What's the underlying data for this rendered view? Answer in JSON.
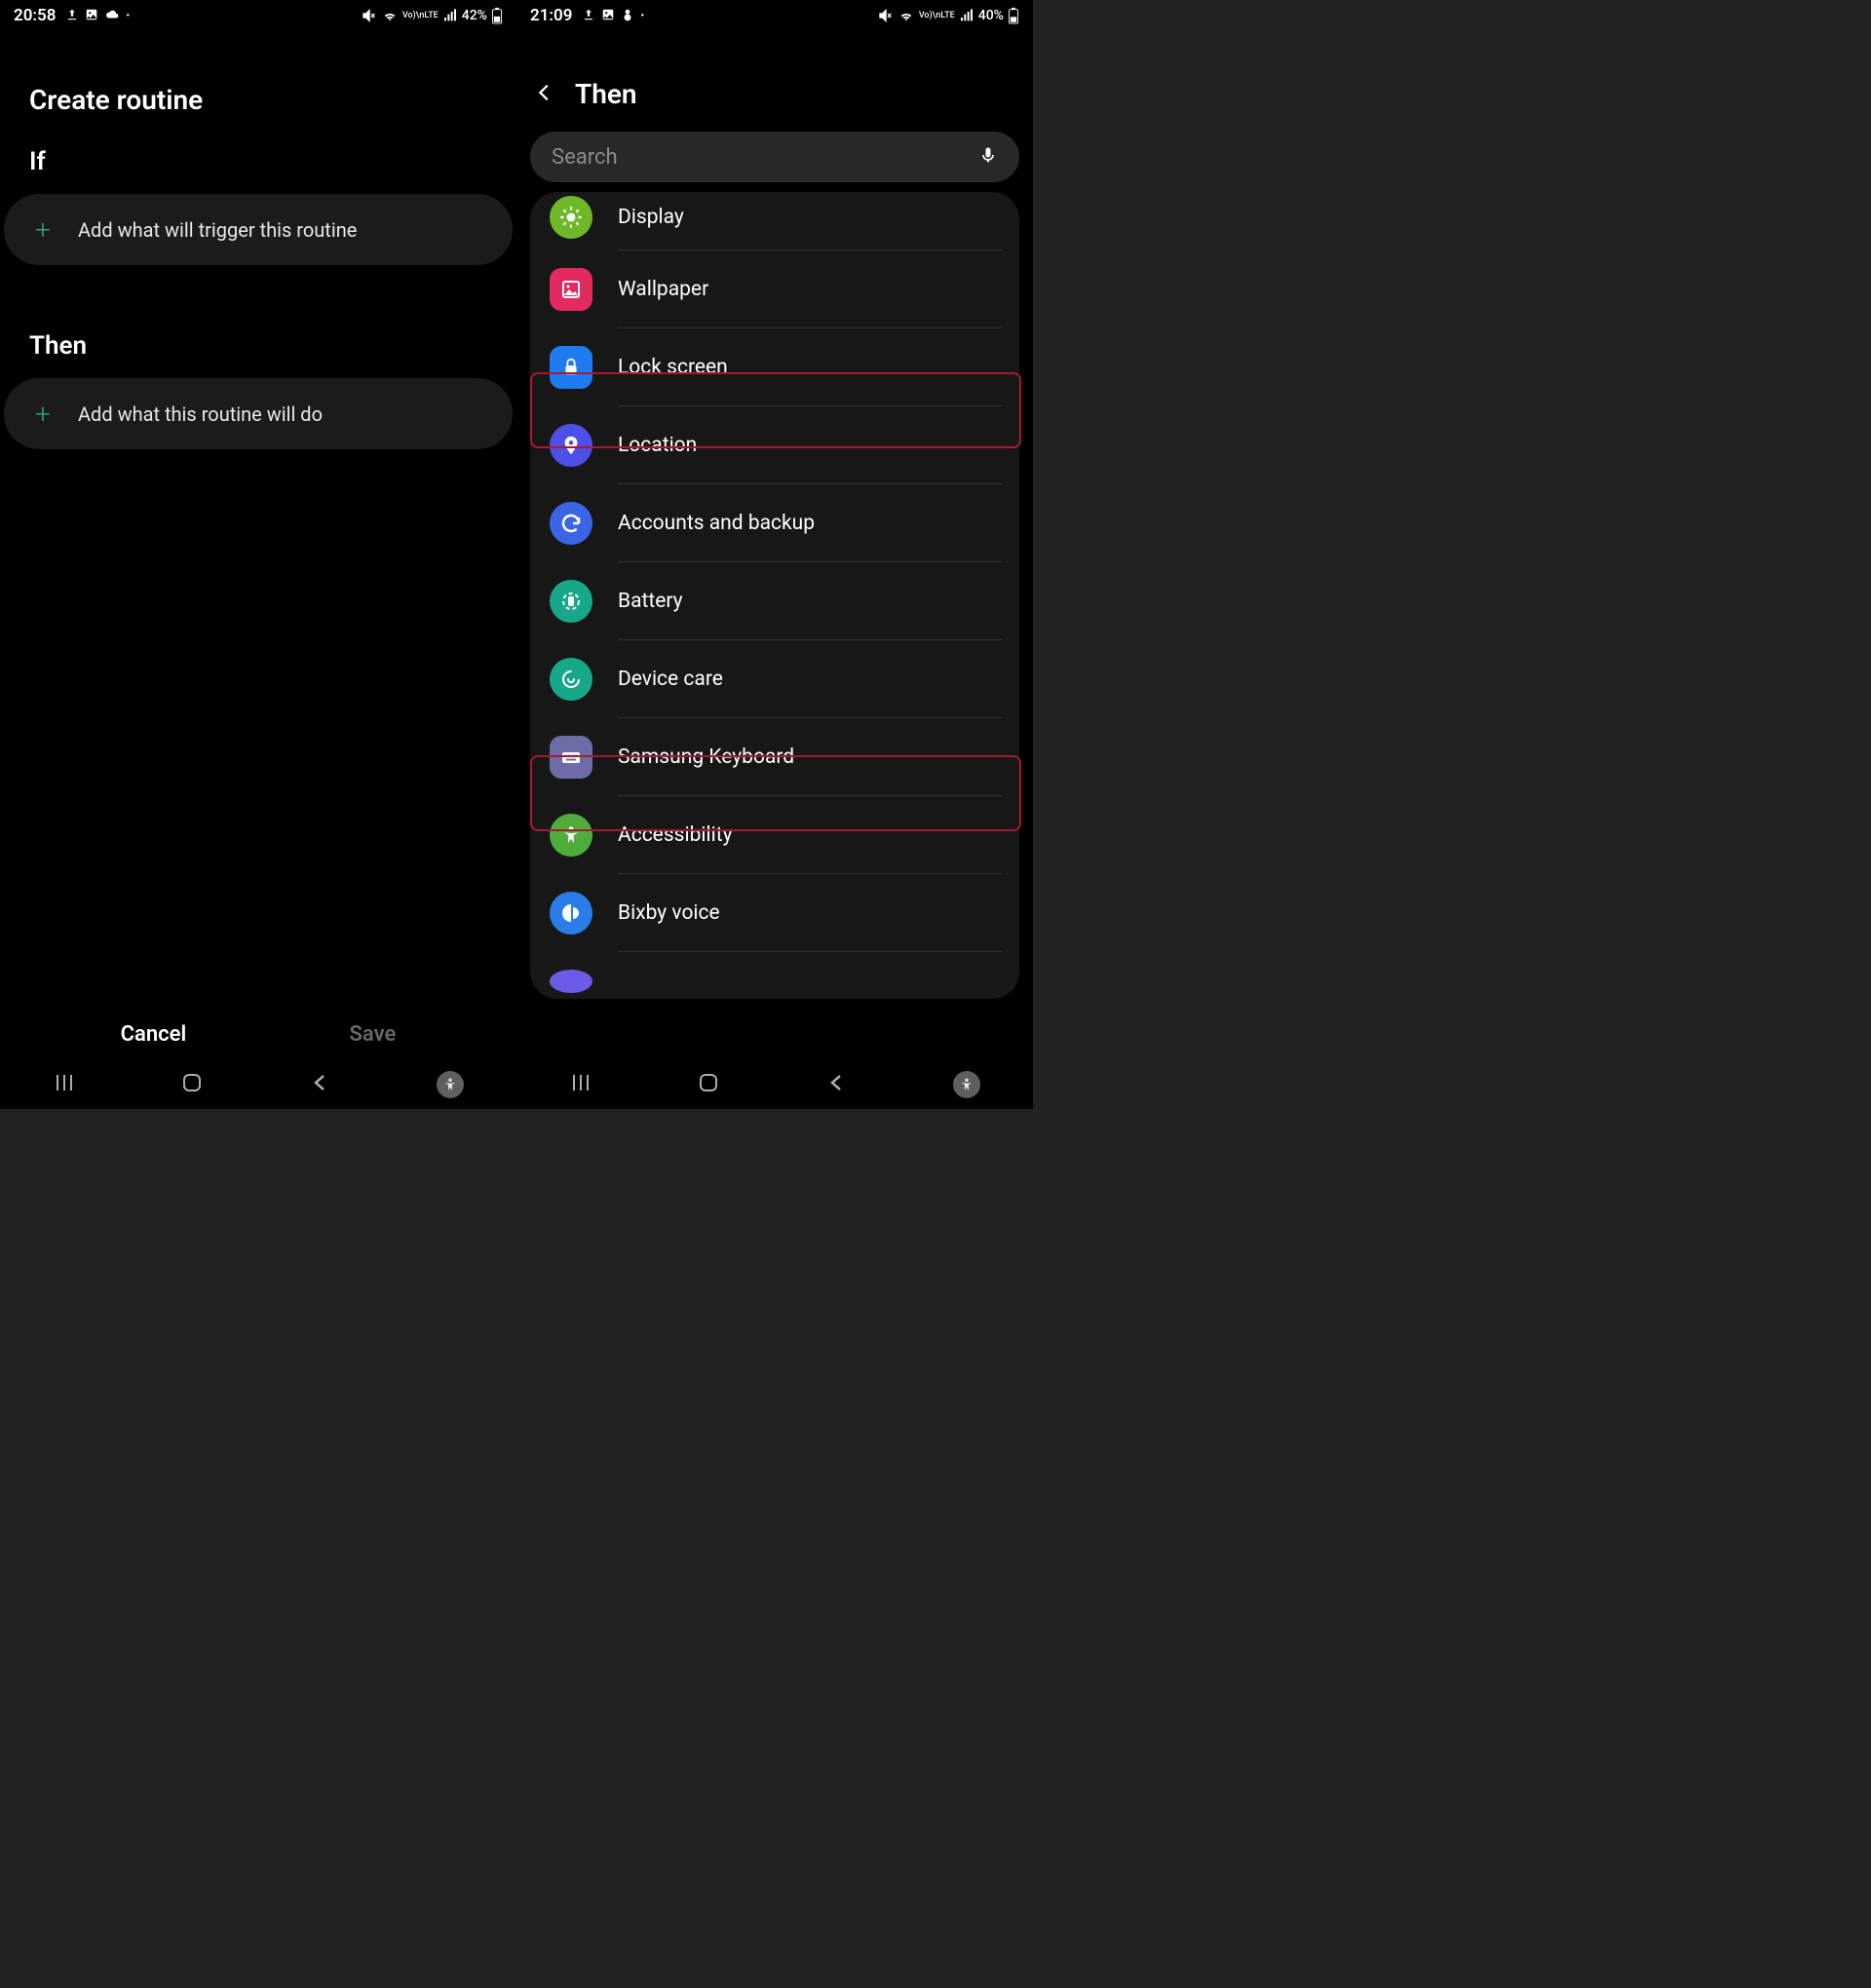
{
  "left": {
    "status": {
      "time": "20:58",
      "battery": "42%"
    },
    "title": "Create routine",
    "if_heading": "If",
    "if_action": "Add what will trigger this routine",
    "then_heading": "Then",
    "then_action": "Add what this routine will do",
    "cancel": "Cancel",
    "save": "Save"
  },
  "right": {
    "status": {
      "time": "21:09",
      "battery": "40%"
    },
    "title": "Then",
    "search_placeholder": "Search",
    "items": [
      {
        "label": "Display",
        "bg": "#6fb82a"
      },
      {
        "label": "Wallpaper",
        "bg": "#e22a5e"
      },
      {
        "label": "Lock screen",
        "bg": "#1e7cf0"
      },
      {
        "label": "Location",
        "bg": "#4e4fe8"
      },
      {
        "label": "Accounts and backup",
        "bg": "#3a66e6"
      },
      {
        "label": "Battery",
        "bg": "#17a889"
      },
      {
        "label": "Device care",
        "bg": "#17a889"
      },
      {
        "label": "Samsung Keyboard",
        "bg": "#6c6ca7"
      },
      {
        "label": "Accessibility",
        "bg": "#4fae3b"
      },
      {
        "label": "Bixby voice",
        "bg": "#2a7de8"
      }
    ]
  }
}
